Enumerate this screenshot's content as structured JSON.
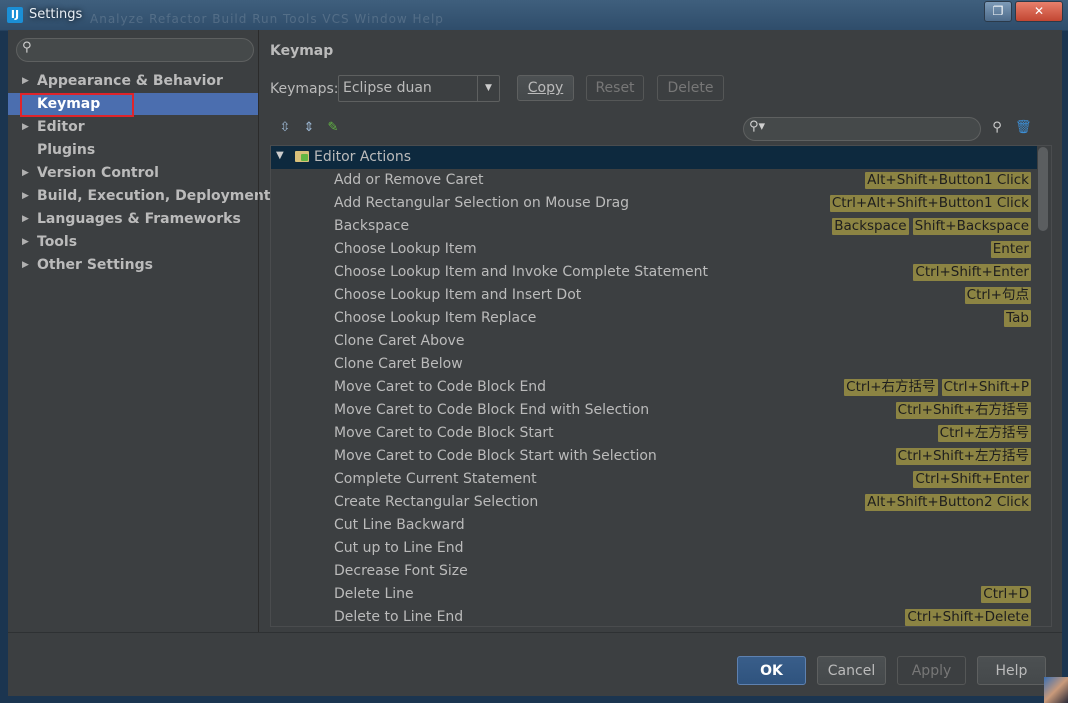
{
  "window": {
    "title": "Settings",
    "icon_label": "IJ",
    "ghost_menu": "Analyze   Refactor   Build   Run   Tools   VCS   Window   Help"
  },
  "sidebar": {
    "search_placeholder": "",
    "items": [
      {
        "label": "Appearance & Behavior",
        "expandable": true
      },
      {
        "label": "Keymap",
        "expandable": false,
        "selected": true
      },
      {
        "label": "Editor",
        "expandable": true
      },
      {
        "label": "Plugins",
        "expandable": false
      },
      {
        "label": "Version Control",
        "expandable": true
      },
      {
        "label": "Build, Execution, Deployment",
        "expandable": true
      },
      {
        "label": "Languages & Frameworks",
        "expandable": true
      },
      {
        "label": "Tools",
        "expandable": true
      },
      {
        "label": "Other Settings",
        "expandable": true
      }
    ]
  },
  "main": {
    "title": "Keymap",
    "keymaps_label": "Keymaps:",
    "keymap_selected": "Eclipse duan",
    "copy": "Copy",
    "reset": "Reset",
    "delete": "Delete",
    "filter_placeholder": ""
  },
  "tree": {
    "group": "Editor Actions",
    "actions": [
      {
        "name": "Add or Remove Caret",
        "keys": [
          "Alt+Shift+Button1 Click"
        ]
      },
      {
        "name": "Add Rectangular Selection on Mouse Drag",
        "keys": [
          "Ctrl+Alt+Shift+Button1 Click"
        ]
      },
      {
        "name": "Backspace",
        "keys": [
          "Backspace",
          "Shift+Backspace"
        ]
      },
      {
        "name": "Choose Lookup Item",
        "keys": [
          "Enter"
        ]
      },
      {
        "name": "Choose Lookup Item and Invoke Complete Statement",
        "keys": [
          "Ctrl+Shift+Enter"
        ]
      },
      {
        "name": "Choose Lookup Item and Insert Dot",
        "keys": [
          "Ctrl+句点"
        ]
      },
      {
        "name": "Choose Lookup Item Replace",
        "keys": [
          "Tab"
        ]
      },
      {
        "name": "Clone Caret Above",
        "keys": []
      },
      {
        "name": "Clone Caret Below",
        "keys": []
      },
      {
        "name": "Move Caret to Code Block End",
        "keys": [
          "Ctrl+右方括号",
          "Ctrl+Shift+P"
        ]
      },
      {
        "name": "Move Caret to Code Block End with Selection",
        "keys": [
          "Ctrl+Shift+右方括号"
        ]
      },
      {
        "name": "Move Caret to Code Block Start",
        "keys": [
          "Ctrl+左方括号"
        ]
      },
      {
        "name": "Move Caret to Code Block Start with Selection",
        "keys": [
          "Ctrl+Shift+左方括号"
        ]
      },
      {
        "name": "Complete Current Statement",
        "keys": [
          "Ctrl+Shift+Enter"
        ]
      },
      {
        "name": "Create Rectangular Selection",
        "keys": [
          "Alt+Shift+Button2 Click"
        ]
      },
      {
        "name": "Cut Line Backward",
        "keys": []
      },
      {
        "name": "Cut up to Line End",
        "keys": []
      },
      {
        "name": "Decrease Font Size",
        "keys": []
      },
      {
        "name": "Delete Line",
        "keys": [
          "Ctrl+D"
        ]
      },
      {
        "name": "Delete to Line End",
        "keys": [
          "Ctrl+Shift+Delete"
        ]
      }
    ]
  },
  "footer": {
    "ok": "OK",
    "cancel": "Cancel",
    "apply": "Apply",
    "help": "Help"
  },
  "colors": {
    "background": "#3c3f41",
    "selection": "#4b6eaf",
    "shortcut_bg": "#8c8443",
    "highlight_outline": "#e0242a",
    "group_row_bg": "#0d293e"
  }
}
